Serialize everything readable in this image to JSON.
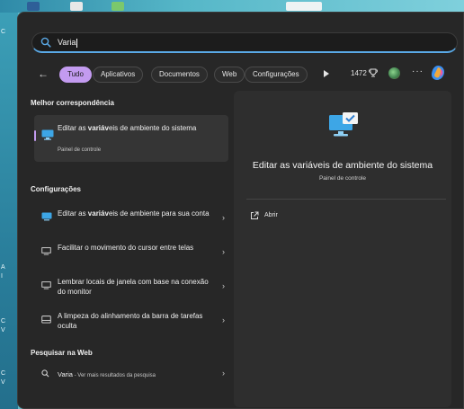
{
  "search": {
    "query": "Varia"
  },
  "filters": {
    "back": "←",
    "chips": [
      "Tudo",
      "Aplicativos",
      "Documentos",
      "Web",
      "Configurações"
    ],
    "active_chip": "Tudo",
    "points": "1472"
  },
  "results": {
    "best_match_title": "Melhor correspondência",
    "best_match": {
      "title_before": "Editar as ",
      "title_bold": "variáv",
      "title_after": "eis de ambiente do sistema",
      "subtitle": "Painel de controle"
    },
    "settings_title": "Configurações",
    "settings": [
      {
        "pre": "Editar as ",
        "bold": "variáv",
        "post": "eis de ambiente para sua conta"
      },
      {
        "pre": "Facilitar o movimento do cursor entre telas",
        "bold": "",
        "post": ""
      },
      {
        "pre": "Lembrar locais de janela com base na conexão do monitor",
        "bold": "",
        "post": ""
      },
      {
        "pre": "A limpeza do alinhamento da barra de tarefas oculta",
        "bold": "",
        "post": ""
      }
    ],
    "web_title": "Pesquisar na Web",
    "web": {
      "query": "Varia",
      "suffix": " - Ver mais resultados da pesquisa"
    }
  },
  "detail": {
    "title": "Editar as variáveis de ambiente do sistema",
    "subtitle": "Painel de controle",
    "open_label": "Abrir"
  },
  "colors": {
    "accent": "#c39bf0",
    "panel": "#272727",
    "search_underline": "#5aa9e6"
  }
}
